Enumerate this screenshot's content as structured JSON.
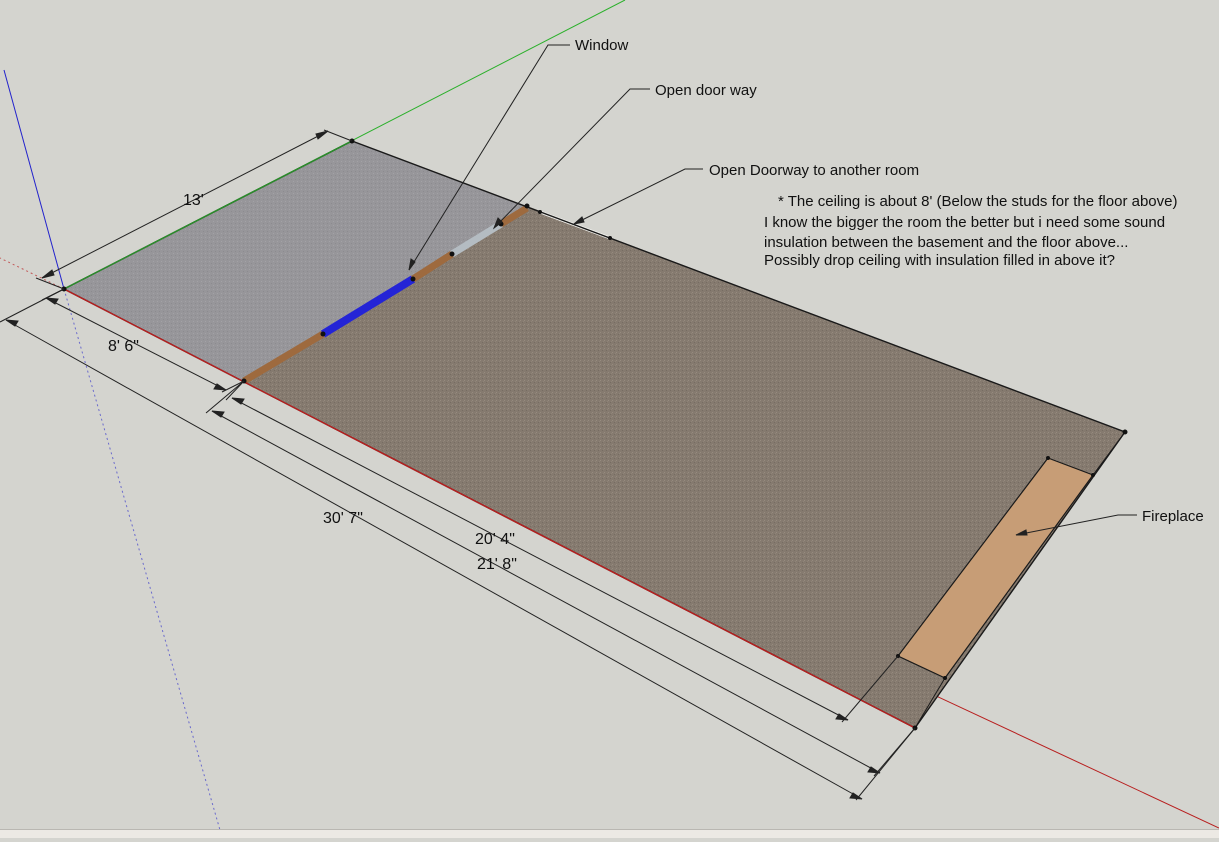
{
  "labels": {
    "window": "Window",
    "open_door_way": "Open door way",
    "open_doorway_another_room": "Open Doorway to another room",
    "fireplace": "Fireplace"
  },
  "dimensions": {
    "width_13": "13'",
    "len_8_6": "8' 6\"",
    "len_30_7": "30' 7\"",
    "len_20_4": "20' 4\"",
    "len_21_8": "21' 8\""
  },
  "note": {
    "line1": "* The ceiling is about 8' (Below the studs for the floor above)",
    "line2": "I know the bigger the room the better but i need some sound",
    "line3": "insulation between the basement and the floor above...",
    "line4": "Possibly drop ceiling with insulation filled in above it?"
  },
  "colors": {
    "background": "#d4d4cf",
    "carpet": "#857a6f",
    "gray_floor": "#97969a",
    "window_blue": "#2424d6",
    "door_brown": "#9e6a3e",
    "doorway_light": "#b4bcc2",
    "fireplace": "#c79d76",
    "axis_red": "#b81e1e",
    "axis_green": "#2bb02b",
    "axis_blue": "#2222cc"
  }
}
